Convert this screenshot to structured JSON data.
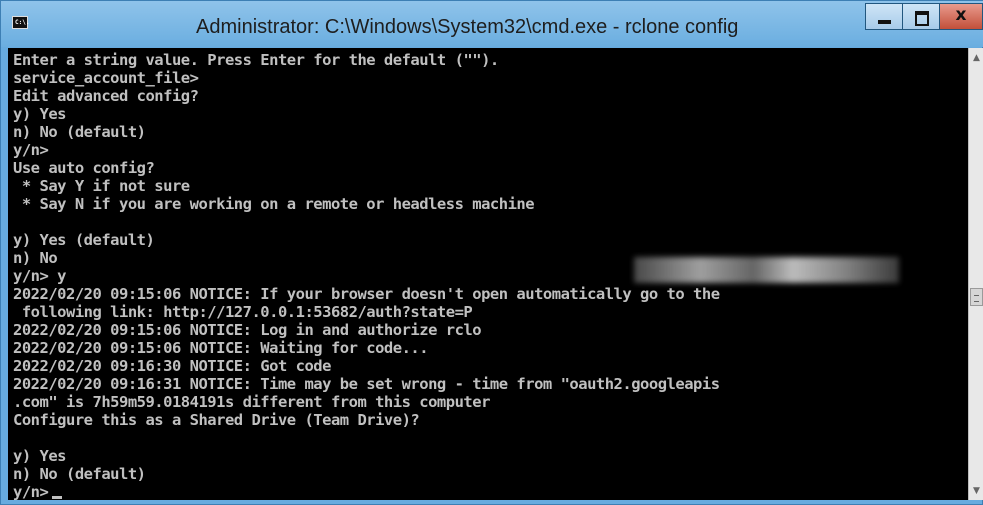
{
  "window": {
    "title": "Administrator: C:\\Windows\\System32\\cmd.exe - rclone  config",
    "app_icon_text": "C:\\."
  },
  "console": {
    "lines": [
      "Enter a string value. Press Enter for the default (\"\").",
      "service_account_file>",
      "Edit advanced config?",
      "y) Yes",
      "n) No (default)",
      "y/n>",
      "Use auto config?",
      " * Say Y if not sure",
      " * Say N if you are working on a remote or headless machine",
      "",
      "y) Yes (default)",
      "n) No",
      "y/n> y",
      "2022/02/20 09:15:06 NOTICE: If your browser doesn't open automatically go to the",
      " following link: http://127.0.0.1:53682/auth?state=P",
      "2022/02/20 09:15:06 NOTICE: Log in and authorize rclo",
      "2022/02/20 09:15:06 NOTICE: Waiting for code...",
      "2022/02/20 09:16:30 NOTICE: Got code",
      "2022/02/20 09:16:31 NOTICE: Time may be set wrong - time from \"oauth2.googleapis",
      ".com\" is 7h59m59.0184191s different from this computer",
      "Configure this as a Shared Drive (Team Drive)?",
      "",
      "y) Yes",
      "n) No (default)",
      "y/n>"
    ]
  },
  "colors": {
    "console_bg": "#000000",
    "console_text": "#c0c0c0",
    "titlebar": "#6aaee0",
    "close_button": "#c24f3a"
  },
  "icons": {
    "app": "cmd-icon",
    "minimize": "minimize-icon",
    "maximize": "maximize-icon",
    "close": "close-icon"
  }
}
